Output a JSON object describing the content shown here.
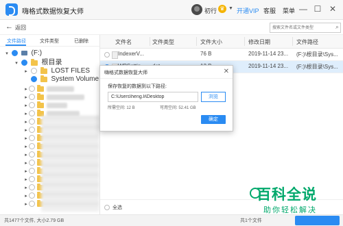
{
  "app": {
    "title": "嗨格式数据恢复大师",
    "user_name": "初行",
    "crown_glyph": "♛",
    "dropdown_glyph": "▼",
    "vip_link": "开通VIP",
    "service_link": "客服",
    "menu_link": "菜单",
    "window_controls": [
      "—",
      "☐",
      "✕"
    ]
  },
  "nav": {
    "back_glyph": "←",
    "back_label": "返回",
    "search_placeholder": "搜索文件名或文件类型",
    "search_glyph": "⌕"
  },
  "left_tabs": [
    "文件路径",
    "文件类型",
    "已删除"
  ],
  "tree": {
    "drive_label": "(F:)",
    "root_label": "根目录",
    "items": [
      "LOST FILES",
      "System Volume I"
    ]
  },
  "table": {
    "columns": [
      "文件名",
      "文件类型",
      "文件大小",
      "修改日期",
      "文件路径"
    ],
    "rows": [
      {
        "name": "IndexerV...",
        "type": "",
        "size": "76 B",
        "date": "2019-11-14 23...",
        "path": "(F:)\\根目录\\Sys..."
      },
      {
        "name": "WPSettin...",
        "type": "dat",
        "size": "12 B",
        "date": "2019-11-14 23...",
        "path": "(F:)\\根目录\\Sys..."
      }
    ],
    "select_all_label": "全选"
  },
  "status": {
    "total": "共1477个文件, 大小2.79 GB",
    "selected": "共1个文件"
  },
  "dialog": {
    "title": "嗨格式数据恢复大师",
    "close_glyph": "✕",
    "prompt": "保存恢复的数据到以下路径:",
    "path_value": "C:\\Users\\heng.li\\Desktop",
    "browse_label": "浏览",
    "required_space": "所需空间:  12 B",
    "available_space": "可用空间:  52.41 GB",
    "ok_label": "确定"
  },
  "watermark": {
    "big": "百科全说",
    "small": "助你轻松解决"
  },
  "colors": {
    "accent": "#2a8bf2",
    "selected_row": "#dfeefc",
    "watermark": "#00a86b"
  }
}
